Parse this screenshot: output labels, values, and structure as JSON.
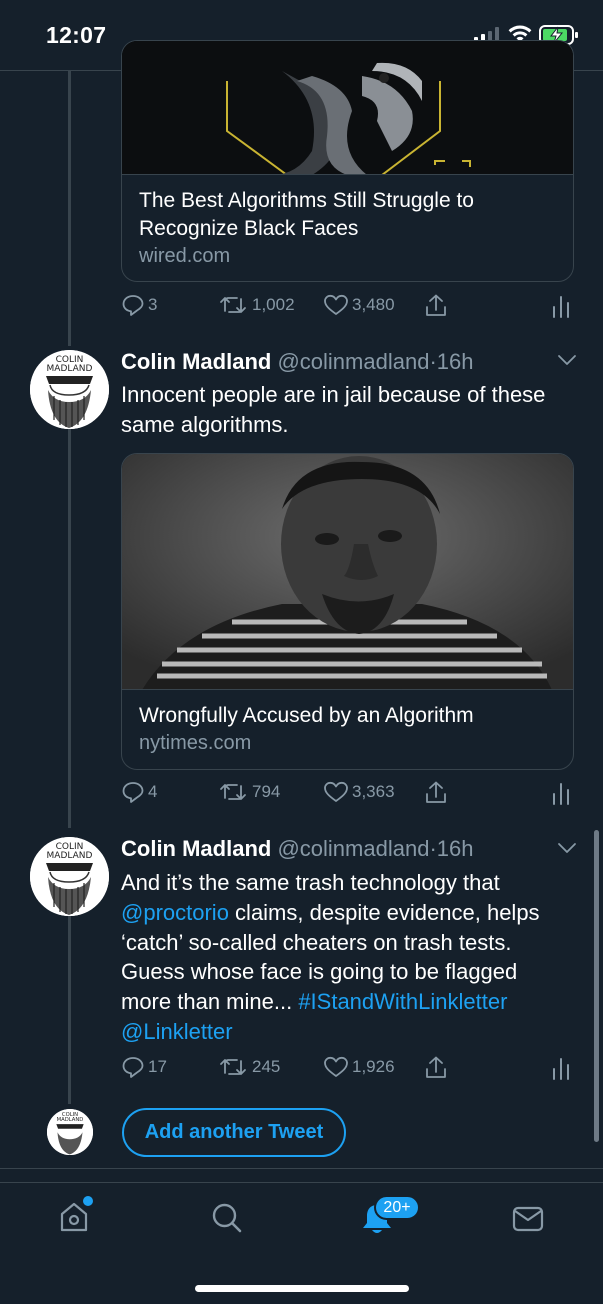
{
  "status_bar": {
    "time": "12:07"
  },
  "tweets": [
    {
      "card": {
        "title": "The Best Algorithms Still Struggle to Recognize Black Faces",
        "domain": "wired.com"
      },
      "actions": {
        "replies": "3",
        "retweets": "1,002",
        "likes": "3,480"
      }
    },
    {
      "name": "Colin Madland",
      "handle": "@colinmadland",
      "sep": "·",
      "time": "16h",
      "text": "Innocent people are in jail because of these same algorithms.",
      "card": {
        "title": "Wrongfully Accused by an Algorithm",
        "domain": "nytimes.com"
      },
      "actions": {
        "replies": "4",
        "retweets": "794",
        "likes": "3,363"
      }
    },
    {
      "name": "Colin Madland",
      "handle": "@colinmadland",
      "sep": "·",
      "time": "16h",
      "text_parts": [
        "And it’s the same trash technology that ",
        "@proctorio",
        " claims, despite evidence, helps ‘catch’ so-called cheaters on trash tests. Guess whose face is going to be flagged more than mine... ",
        "#IStandWithLinkletter",
        " ",
        "@Linkletter"
      ],
      "actions": {
        "replies": "17",
        "retweets": "245",
        "likes": "1,926"
      }
    }
  ],
  "avatar_text": {
    "line1": "COLIN",
    "line2": "MADLAND"
  },
  "add_tweet_label": "Add another Tweet",
  "tabbar": {
    "notifications_badge": "20+"
  },
  "icons": [
    "home-icon",
    "search-icon",
    "notifications-icon",
    "messages-icon",
    "reply-icon",
    "retweet-icon",
    "like-icon",
    "share-icon",
    "analytics-icon",
    "chevron-down-icon"
  ],
  "colors": {
    "background": "#15202b",
    "accent": "#1da1f2",
    "secondary_text": "#8899a6",
    "border": "#38444d"
  }
}
